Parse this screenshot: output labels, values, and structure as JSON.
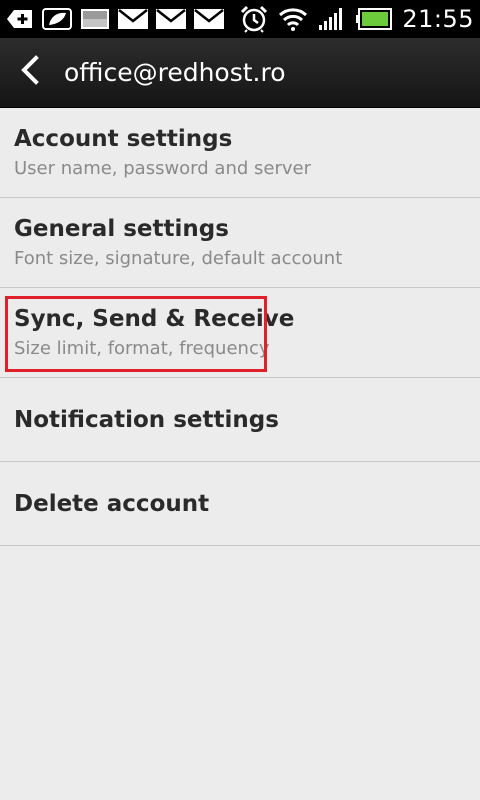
{
  "status_bar": {
    "time": "21:55",
    "left_icons": [
      "add-notification-icon",
      "leaf-icon",
      "gallery-icon",
      "mail-icon",
      "mail-icon",
      "mail-icon"
    ],
    "right_icons": [
      "alarm-icon",
      "wifi-icon",
      "signal-icon",
      "battery-icon"
    ],
    "battery_color": "#6ccb3a"
  },
  "action_bar": {
    "title": "office@redhost.ro"
  },
  "settings": [
    {
      "title": "Account settings",
      "subtitle": "User name, password and server"
    },
    {
      "title": "General settings",
      "subtitle": "Font size, signature, default account"
    },
    {
      "title": "Sync, Send & Receive",
      "subtitle": "Size limit, format, frequency",
      "highlighted": true
    },
    {
      "title": "Notification settings"
    },
    {
      "title": "Delete account"
    }
  ],
  "colors": {
    "background": "#ececec",
    "highlight": "#e0202a"
  }
}
